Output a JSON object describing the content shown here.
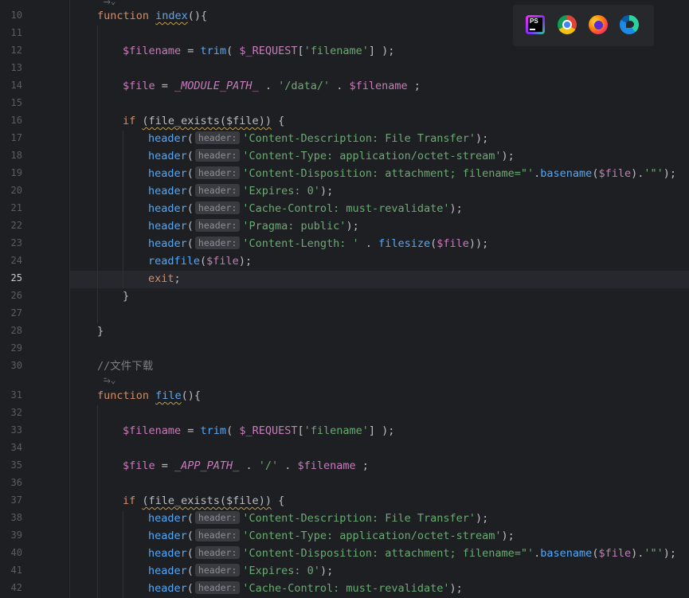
{
  "editor": {
    "current_line": "25",
    "code_lens_glyph": "⥲⌄",
    "lines": [
      {
        "n": "10",
        "tokens": [
          [
            "kw",
            "function "
          ],
          [
            "fnu",
            "index"
          ],
          [
            "w",
            "(){"
          ]
        ]
      },
      {
        "n": "11",
        "tokens": []
      },
      {
        "n": "12",
        "tokens": [
          [
            "v",
            "$filename"
          ],
          [
            "w",
            " = "
          ],
          [
            "fn",
            "trim"
          ],
          [
            "w",
            "( "
          ],
          [
            "v",
            "$_REQUEST"
          ],
          [
            "w",
            "["
          ],
          [
            "s",
            "'filename'"
          ],
          [
            "w",
            "] );"
          ]
        ]
      },
      {
        "n": "13",
        "tokens": []
      },
      {
        "n": "14",
        "tokens": [
          [
            "v",
            "$file"
          ],
          [
            "w",
            " = "
          ],
          [
            "k",
            "_MODULE_PATH_"
          ],
          [
            "w",
            " . "
          ],
          [
            "s",
            "'/data/'"
          ],
          [
            "w",
            " . "
          ],
          [
            "v",
            "$filename"
          ],
          [
            "w",
            " ;"
          ]
        ]
      },
      {
        "n": "15",
        "tokens": []
      },
      {
        "n": "16",
        "tokens": [
          [
            "kw",
            "if "
          ],
          [
            "ifu",
            "(file_exists($file))"
          ],
          [
            "w",
            " {"
          ]
        ]
      },
      {
        "n": "17",
        "tokens": [
          [
            "fn",
            "header"
          ],
          [
            "w",
            "("
          ],
          [
            "hint",
            "header:"
          ],
          [
            "s",
            "'Content-Description: File Transfer'"
          ],
          [
            "w",
            ");"
          ]
        ]
      },
      {
        "n": "18",
        "tokens": [
          [
            "fn",
            "header"
          ],
          [
            "w",
            "("
          ],
          [
            "hint",
            "header:"
          ],
          [
            "s",
            "'Content-Type: application/octet-stream'"
          ],
          [
            "w",
            ");"
          ]
        ]
      },
      {
        "n": "19",
        "tokens": [
          [
            "fn",
            "header"
          ],
          [
            "w",
            "("
          ],
          [
            "hint",
            "header:"
          ],
          [
            "s",
            "'Content-Disposition: attachment; filename=\"'"
          ],
          [
            "w",
            "."
          ],
          [
            "fn",
            "basename"
          ],
          [
            "w",
            "("
          ],
          [
            "v",
            "$file"
          ],
          [
            "w",
            ")."
          ],
          [
            "s",
            "'\"'"
          ],
          [
            "w",
            ");"
          ]
        ]
      },
      {
        "n": "20",
        "tokens": [
          [
            "fn",
            "header"
          ],
          [
            "w",
            "("
          ],
          [
            "hint",
            "header:"
          ],
          [
            "s",
            "'Expires: 0'"
          ],
          [
            "w",
            ");"
          ]
        ]
      },
      {
        "n": "21",
        "tokens": [
          [
            "fn",
            "header"
          ],
          [
            "w",
            "("
          ],
          [
            "hint",
            "header:"
          ],
          [
            "s",
            "'Cache-Control: must-revalidate'"
          ],
          [
            "w",
            ");"
          ]
        ]
      },
      {
        "n": "22",
        "tokens": [
          [
            "fn",
            "header"
          ],
          [
            "w",
            "("
          ],
          [
            "hint",
            "header:"
          ],
          [
            "s",
            "'Pragma: public'"
          ],
          [
            "w",
            ");"
          ]
        ]
      },
      {
        "n": "23",
        "tokens": [
          [
            "fn",
            "header"
          ],
          [
            "w",
            "("
          ],
          [
            "hint",
            "header:"
          ],
          [
            "s",
            "'Content-Length: '"
          ],
          [
            "w",
            " . "
          ],
          [
            "fn",
            "filesize"
          ],
          [
            "w",
            "("
          ],
          [
            "v",
            "$file"
          ],
          [
            "w",
            "));"
          ]
        ]
      },
      {
        "n": "24",
        "tokens": [
          [
            "fn",
            "readfile"
          ],
          [
            "w",
            "("
          ],
          [
            "v",
            "$file"
          ],
          [
            "w",
            ");"
          ]
        ]
      },
      {
        "n": "25",
        "tokens": [
          [
            "kw",
            "exit"
          ],
          [
            "w",
            ";"
          ]
        ]
      },
      {
        "n": "26",
        "tokens": [
          [
            "w",
            "}"
          ]
        ]
      },
      {
        "n": "27",
        "tokens": []
      },
      {
        "n": "28",
        "tokens": [
          [
            "w",
            "}"
          ]
        ]
      },
      {
        "n": "29",
        "tokens": []
      },
      {
        "n": "30",
        "tokens": [
          [
            "c",
            "//文件下载"
          ]
        ]
      },
      {
        "n": "31",
        "tokens": [
          [
            "kw",
            "function "
          ],
          [
            "fnu",
            "file"
          ],
          [
            "w",
            "(){"
          ]
        ]
      },
      {
        "n": "32",
        "tokens": []
      },
      {
        "n": "33",
        "tokens": [
          [
            "v",
            "$filename"
          ],
          [
            "w",
            " = "
          ],
          [
            "fn",
            "trim"
          ],
          [
            "w",
            "( "
          ],
          [
            "v",
            "$_REQUEST"
          ],
          [
            "w",
            "["
          ],
          [
            "s",
            "'filename'"
          ],
          [
            "w",
            "] );"
          ]
        ]
      },
      {
        "n": "34",
        "tokens": []
      },
      {
        "n": "35",
        "tokens": [
          [
            "v",
            "$file"
          ],
          [
            "w",
            " = "
          ],
          [
            "k",
            "_APP_PATH_"
          ],
          [
            "w",
            " . "
          ],
          [
            "s",
            "'/'"
          ],
          [
            "w",
            " . "
          ],
          [
            "v",
            "$filename"
          ],
          [
            "w",
            " ;"
          ]
        ]
      },
      {
        "n": "36",
        "tokens": []
      },
      {
        "n": "37",
        "tokens": [
          [
            "kw",
            "if "
          ],
          [
            "ifu",
            "(file_exists($file))"
          ],
          [
            "w",
            " {"
          ]
        ]
      },
      {
        "n": "38",
        "tokens": [
          [
            "fn",
            "header"
          ],
          [
            "w",
            "("
          ],
          [
            "hint",
            "header:"
          ],
          [
            "s",
            "'Content-Description: File Transfer'"
          ],
          [
            "w",
            ");"
          ]
        ]
      },
      {
        "n": "39",
        "tokens": [
          [
            "fn",
            "header"
          ],
          [
            "w",
            "("
          ],
          [
            "hint",
            "header:"
          ],
          [
            "s",
            "'Content-Type: application/octet-stream'"
          ],
          [
            "w",
            ");"
          ]
        ]
      },
      {
        "n": "40",
        "tokens": [
          [
            "fn",
            "header"
          ],
          [
            "w",
            "("
          ],
          [
            "hint",
            "header:"
          ],
          [
            "s",
            "'Content-Disposition: attachment; filename=\"'"
          ],
          [
            "w",
            "."
          ],
          [
            "fn",
            "basename"
          ],
          [
            "w",
            "("
          ],
          [
            "v",
            "$file"
          ],
          [
            "w",
            ")."
          ],
          [
            "s",
            "'\"'"
          ],
          [
            "w",
            ");"
          ]
        ]
      },
      {
        "n": "41",
        "tokens": [
          [
            "fn",
            "header"
          ],
          [
            "w",
            "("
          ],
          [
            "hint",
            "header:"
          ],
          [
            "s",
            "'Expires: 0'"
          ],
          [
            "w",
            ");"
          ]
        ]
      },
      {
        "n": "42",
        "tokens": [
          [
            "fn",
            "header"
          ],
          [
            "w",
            "("
          ],
          [
            "hint",
            "header:"
          ],
          [
            "s",
            "'Cache-Control: must-revalidate'"
          ],
          [
            "w",
            ");"
          ]
        ]
      }
    ]
  },
  "browser_bar": {
    "icons": [
      "phpstorm-icon",
      "chrome-icon",
      "firefox-icon",
      "edge-icon"
    ],
    "phpstorm_label": "PS"
  }
}
